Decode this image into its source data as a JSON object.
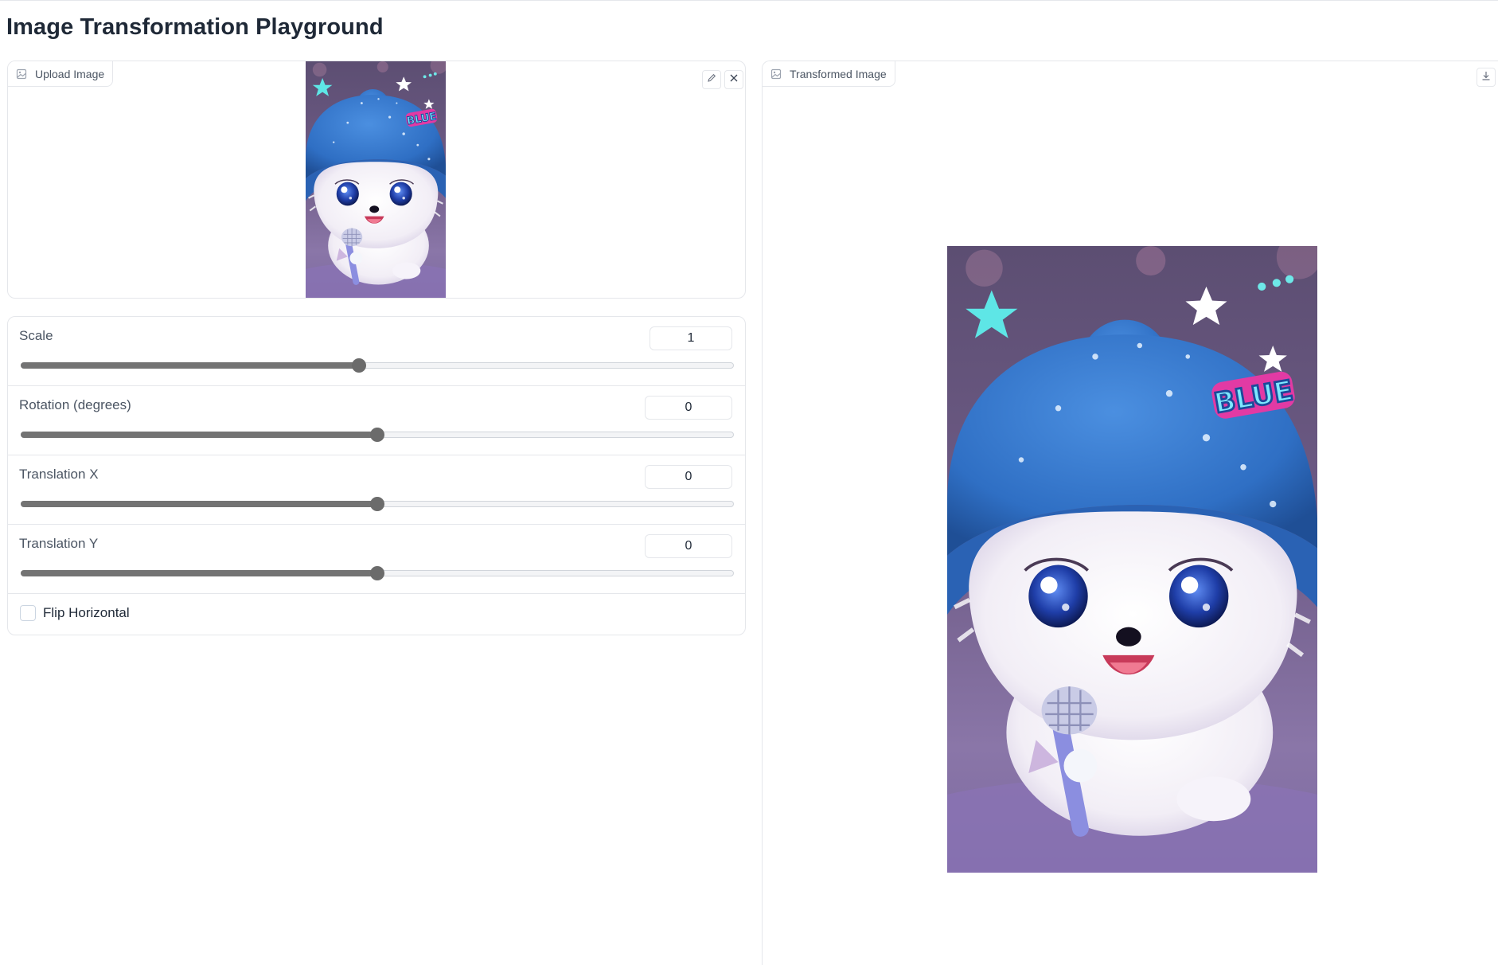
{
  "page": {
    "title": "Image Transformation Playground"
  },
  "upload": {
    "label": "Upload Image",
    "edit_label": "Edit",
    "clear_label": "Clear"
  },
  "controls": {
    "scale": {
      "label": "Scale",
      "value": "1",
      "fraction": 0.474
    },
    "rotation": {
      "label": "Rotation (degrees)",
      "value": "0",
      "fraction": 0.5
    },
    "translation_x": {
      "label": "Translation X",
      "value": "0",
      "fraction": 0.5
    },
    "translation_y": {
      "label": "Translation Y",
      "value": "0",
      "fraction": 0.5
    },
    "flip": {
      "label": "Flip Horizontal",
      "checked": false
    }
  },
  "output": {
    "label": "Transformed Image",
    "download_label": "Download"
  },
  "image_text": {
    "sticker": "BLUE"
  },
  "colors": {
    "accent": "#6b6b6b",
    "hat_blue": "#2f6fc4",
    "background_purple": "#6a5480"
  }
}
